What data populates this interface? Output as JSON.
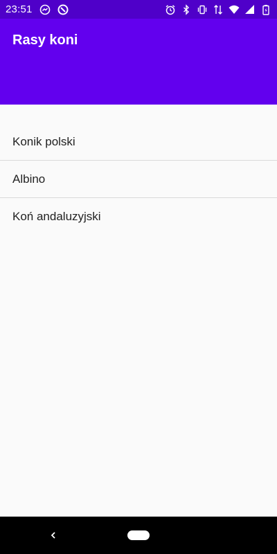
{
  "status_bar": {
    "time": "23:51",
    "icons_left": [
      "messenger-icon",
      "do-not-disturb-icon"
    ],
    "icons_right": [
      "alarm-icon",
      "bluetooth-icon",
      "vibrate-icon",
      "data-icon",
      "wifi-icon",
      "signal-icon",
      "battery-icon"
    ]
  },
  "app_bar": {
    "title": "Rasy koni"
  },
  "list": {
    "items": [
      {
        "label": "Konik polski"
      },
      {
        "label": "Albino"
      },
      {
        "label": "Koń andaluzyjski"
      }
    ]
  },
  "nav_bar": {
    "icons": [
      "back-icon",
      "home-pill-icon"
    ]
  },
  "colors": {
    "status_bar": "#4f00c9",
    "app_bar": "#6200ee",
    "background": "#fafafa",
    "divider": "#d9d9d9",
    "nav_bar": "#000000"
  }
}
